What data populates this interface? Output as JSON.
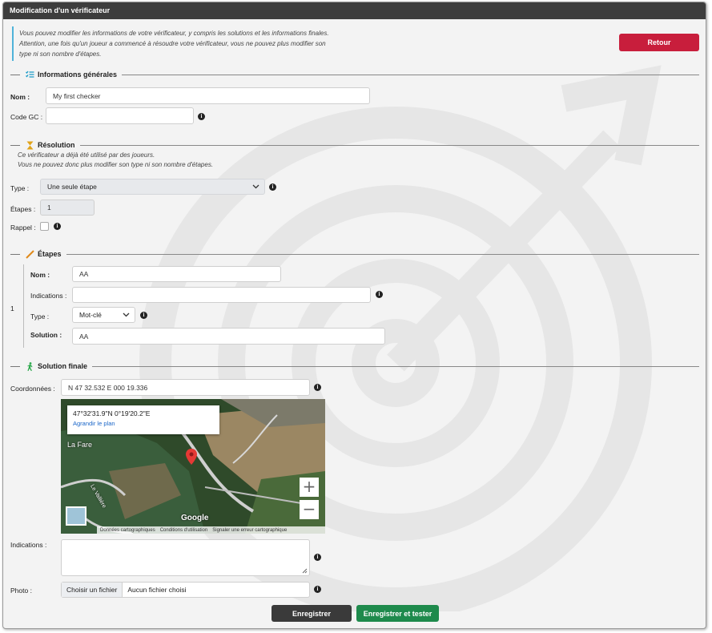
{
  "window": {
    "title": "Modification d'un vérificateur"
  },
  "intro": {
    "lines": [
      "Vous pouvez modifier les informations de votre vérificateur, y compris les solutions et les informations finales.",
      "Attention, une fois qu'un joueur a commencé à résoudre votre vérificateur, vous ne pouvez plus modifier son",
      "type ni son nombre d'étapes."
    ]
  },
  "actions": {
    "back_label": "Retour",
    "save_label": "Enregistrer",
    "save_test_label": "Enregistrer et tester"
  },
  "general": {
    "title": "Informations générales",
    "name_label": "Nom :",
    "name_value": "My first checker",
    "gc_label": "Code GC :",
    "gc_value": ""
  },
  "resolution": {
    "title": "Résolution",
    "notes": [
      "Ce vérificateur a déjà été utilisé par des joueurs.",
      "Vous ne pouvez donc plus modifier son type ni son nombre d'étapes."
    ],
    "type_label": "Type :",
    "type_value": "Une seule étape",
    "steps_label": "Étapes :",
    "steps_value": "1",
    "reminder_label": "Rappel :"
  },
  "steps": {
    "title": "Étapes",
    "index": "1",
    "name_label": "Nom :",
    "name_value": "AA",
    "hints_label": "Indications :",
    "hints_value": "",
    "type_label": "Type :",
    "type_value": "Mot-clé",
    "solution_label": "Solution :",
    "solution_value": "AA"
  },
  "final": {
    "title": "Solution finale",
    "coords_label": "Coordonnées :",
    "coords_value": "N 47 32.532 E 000 19.336",
    "hints_label": "Indications :",
    "photo_label": "Photo :",
    "file_button": "Choisir un fichier",
    "file_status": "Aucun fichier choisi"
  },
  "map": {
    "card_coords": "47°32'31.9\"N 0°19'20.2\"E",
    "card_link": "Agrandir le plan",
    "place_label": "La Fare",
    "road_label": "Le Vallière",
    "logo": "Google",
    "zoom_in": "+",
    "zoom_out": "−",
    "footer": [
      "Données cartographiques",
      "Conditions d'utilisation",
      "Signaler une erreur cartographique"
    ]
  },
  "colors": {
    "accent_red": "#c81e3c",
    "accent_green": "#1e8a4c",
    "title_bar": "#3d3d3d",
    "info_border": "#4fb3d9"
  }
}
